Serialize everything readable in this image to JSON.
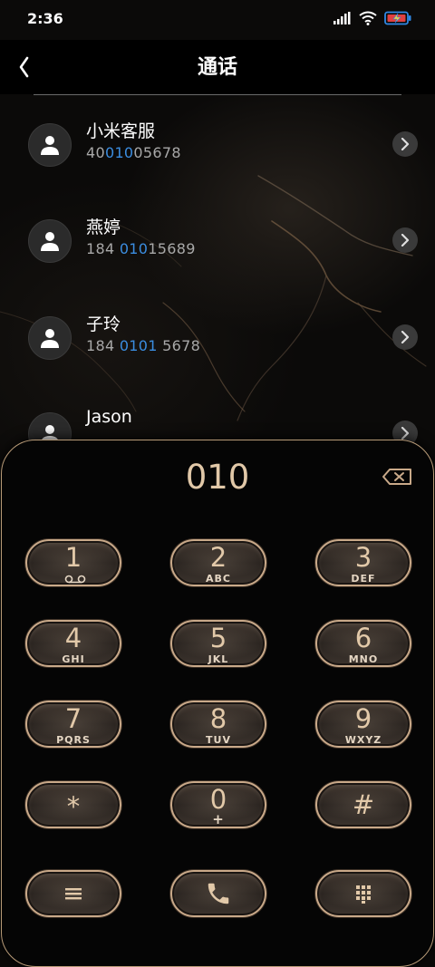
{
  "status_bar": {
    "time": "2:36"
  },
  "header": {
    "title": "通话"
  },
  "contacts": [
    {
      "name": "小米客服",
      "number_pre": "40",
      "number_hl": "010",
      "number_post": "05678"
    },
    {
      "name": "燕婷",
      "number_pre": "184 ",
      "number_hl": "010",
      "number_post": "15689"
    },
    {
      "name": "子玲",
      "number_pre": "184 ",
      "number_hl": "0101",
      "number_post": " 5678"
    },
    {
      "name": "Jason",
      "number_pre": "",
      "number_hl": "",
      "number_post": ""
    }
  ],
  "dialer": {
    "input": "010",
    "keys": [
      {
        "num": "1",
        "sub": ""
      },
      {
        "num": "2",
        "sub": "ABC"
      },
      {
        "num": "3",
        "sub": "DEF"
      },
      {
        "num": "4",
        "sub": "GHI"
      },
      {
        "num": "5",
        "sub": "JKL"
      },
      {
        "num": "6",
        "sub": "MNO"
      },
      {
        "num": "7",
        "sub": "PQRS"
      },
      {
        "num": "8",
        "sub": "TUV"
      },
      {
        "num": "9",
        "sub": "WXYZ"
      },
      {
        "num": "*",
        "sub": ""
      },
      {
        "num": "0",
        "sub": "+"
      },
      {
        "num": "#",
        "sub": ""
      }
    ]
  },
  "colors": {
    "accent": "#c9a989",
    "highlight": "#3b8de0",
    "digits": "#e1c8a8"
  }
}
